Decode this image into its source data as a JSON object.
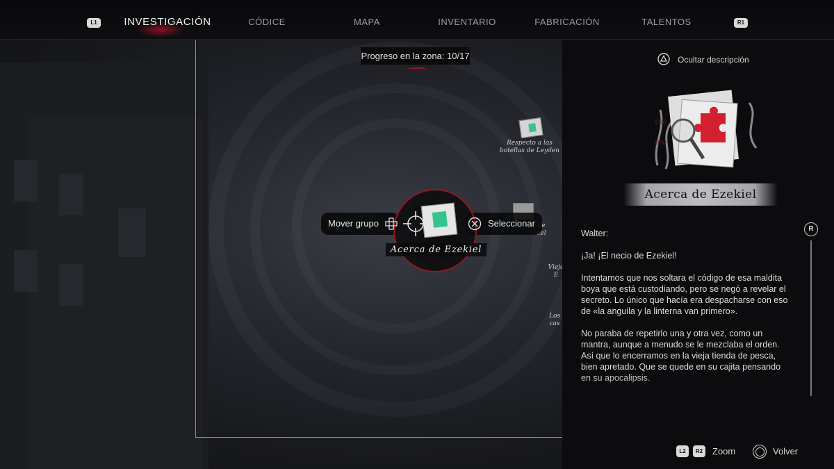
{
  "nav": {
    "left_bumper": "L1",
    "right_bumper": "R1",
    "tabs": [
      {
        "label": "INVESTIGACIÓN",
        "active": true
      },
      {
        "label": "CÓDICE",
        "active": false
      },
      {
        "label": "MAPA",
        "active": false
      },
      {
        "label": "INVENTARIO",
        "active": false
      },
      {
        "label": "FABRICACIÓN",
        "active": false
      },
      {
        "label": "TALENTOS",
        "active": false
      }
    ]
  },
  "map": {
    "progress_text": "Progreso en la zona:  10/17",
    "selected_node": {
      "label": "Acerca de Ezekiel",
      "icon": "puzzle-evidence-icon"
    },
    "nodes": [
      {
        "label_line1": "Respecto a las",
        "label_line2": "botellas de Leyden"
      },
      {
        "label_line1": "de",
        "label_line2": "eel"
      },
      {
        "label_line1": "Viejo",
        "label_line2": "E"
      },
      {
        "label_line1": "Los",
        "label_line2": "cas"
      }
    ],
    "prompt_move": "Mover grupo",
    "prompt_select": "Seleccionar"
  },
  "panel": {
    "hide_description": "Ocultar descripción",
    "title": "Acerca de Ezekiel",
    "scroll_button": "R",
    "description": [
      "Walter:",
      "¡Ja! ¡El necio de Ezekiel!",
      "Intentamos que nos soltara el código de esa maldita boya que está custodiando, pero se negó a revelar el secreto. Lo único que hacía era despacharse con eso de «la anguila y la linterna van primero».",
      "No paraba de repetirlo una y otra vez, como un mantra, aunque a menudo se le mezclaba el orden. Así que lo encerramos en la vieja tienda de pesca, bien apretado. Que se quede en su cajita pensando en su apocalipsis."
    ]
  },
  "footer": {
    "zoom_badge_1": "L2",
    "zoom_badge_2": "R2",
    "zoom_label": "Zoom",
    "back_label": "Volver"
  },
  "colors": {
    "accent_red": "#a8192a",
    "evidence_green": "#35c490"
  }
}
